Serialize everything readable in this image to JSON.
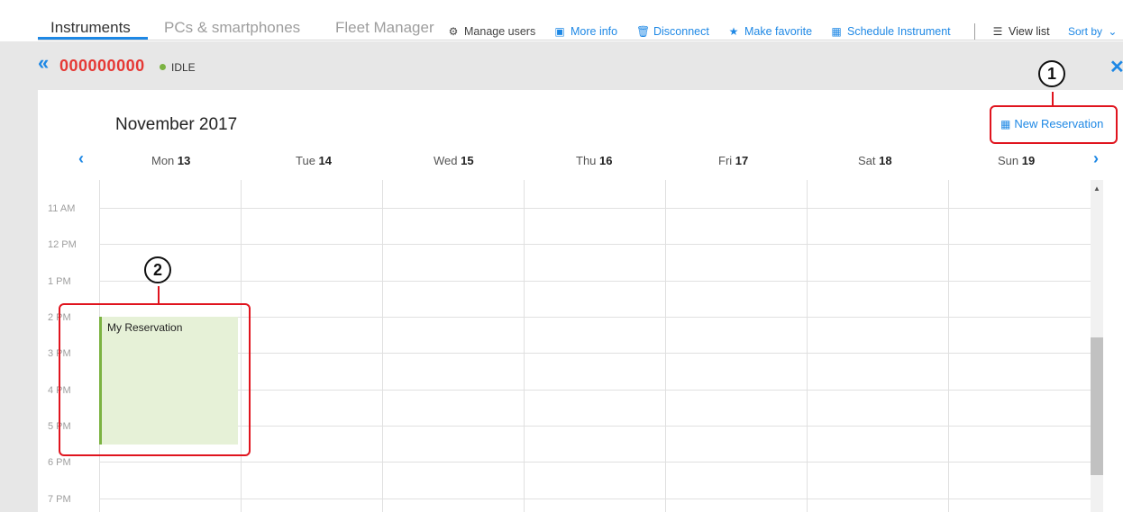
{
  "tabs": [
    {
      "label": "Instruments",
      "active": true
    },
    {
      "label": "PCs & smartphones",
      "active": false
    },
    {
      "label": "Fleet Manager",
      "active": false
    }
  ],
  "actions": {
    "manage_users": {
      "label": "Manage users",
      "icon": "gear-icon"
    },
    "more_info": {
      "label": "More info",
      "icon": "info-icon"
    },
    "disconnect": {
      "label": "Disconnect",
      "icon": "trash-icon"
    },
    "make_favorite": {
      "label": "Make favorite",
      "icon": "star-icon"
    },
    "schedule_instrument": {
      "label": "Schedule Instrument",
      "icon": "calendar-icon"
    },
    "view_list": {
      "label": "View list",
      "icon": "list-icon"
    },
    "sort_by": {
      "label": "Sort by",
      "icon": "chevron-down-icon"
    }
  },
  "instrument": {
    "id": "000000000",
    "status": "IDLE",
    "status_color": "#7cb342",
    "id_color": "#e53935"
  },
  "calendar": {
    "month_title": "November 2017",
    "new_reservation_label": "New Reservation",
    "days": [
      {
        "name": "Mon",
        "num": "13"
      },
      {
        "name": "Tue",
        "num": "14"
      },
      {
        "name": "Wed",
        "num": "15"
      },
      {
        "name": "Thu",
        "num": "16"
      },
      {
        "name": "Fri",
        "num": "17"
      },
      {
        "name": "Sat",
        "num": "18"
      },
      {
        "name": "Sun",
        "num": "19"
      }
    ],
    "hours": [
      "11 AM",
      "12 PM",
      "1 PM",
      "2 PM",
      "3 PM",
      "4 PM",
      "5 PM",
      "6 PM",
      "7 PM"
    ],
    "event": {
      "title": "My Reservation",
      "day": "Mon",
      "start": "2 PM",
      "end": "5:30 PM"
    }
  },
  "callouts": {
    "one": "1",
    "two": "2"
  },
  "colors": {
    "accent": "#1e88e5",
    "callout": "#e0141e",
    "event_fill": "#e6f1d7",
    "event_border": "#7cb342"
  }
}
